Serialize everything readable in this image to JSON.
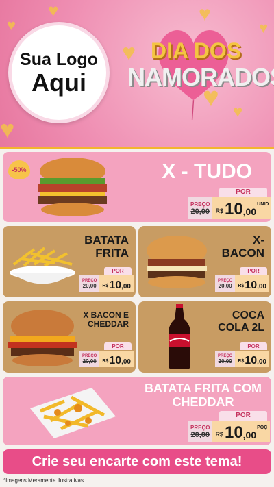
{
  "header": {
    "logo_line1": "Sua Logo",
    "logo_line2": "Aqui",
    "title_line1": "DIA DOS",
    "title_line2": "NAMORADOS"
  },
  "items": [
    {
      "title": "X - TUDO",
      "badge": "-50%",
      "por": "POR",
      "preco_label": "PREÇO",
      "old_prefix": "R$",
      "old_price": "20,00",
      "currency": "R$",
      "price": "10",
      "cents": ",00",
      "unit": "UNID"
    },
    {
      "title_l1": "BATATA",
      "title_l2": "FRITA",
      "por": "POR",
      "preco_label": "PREÇO",
      "old_prefix": "R$",
      "old_price": "20,00",
      "currency": "R$",
      "price": "10",
      "cents": ",00"
    },
    {
      "title_l1": "X-",
      "title_l2": "BACON",
      "por": "POR",
      "preco_label": "PREÇO",
      "old_prefix": "R$",
      "old_price": "20,00",
      "currency": "R$",
      "price": "10",
      "cents": ",00"
    },
    {
      "title_l1": "X BACON E",
      "title_l2": "CHEDDAR",
      "por": "POR",
      "preco_label": "PREÇO",
      "old_prefix": "R$",
      "old_price": "20,00",
      "currency": "R$",
      "price": "10",
      "cents": ",00"
    },
    {
      "title_l1": "COCA",
      "title_l2": "COLA 2L",
      "por": "POR",
      "preco_label": "PREÇO",
      "old_prefix": "R$",
      "old_price": "20,00",
      "currency": "R$",
      "price": "10",
      "cents": ",00"
    },
    {
      "title_l1": "BATATA FRITA COM",
      "title_l2": "CHEDDAR",
      "por": "POR",
      "preco_label": "PREÇO",
      "old_prefix": "R$",
      "old_price": "20,00",
      "currency": "R$",
      "price": "10",
      "cents": ",00",
      "unit": "POÇ"
    }
  ],
  "cta_text": "Crie seu encarte com este tema!",
  "footnote": "*Imagens Meramente Ilustrativas",
  "colors": {
    "pink_card": "#f4a3bf",
    "tan_card": "#c89c63",
    "cta": "#e84d88",
    "gold": "#f3b52e"
  }
}
